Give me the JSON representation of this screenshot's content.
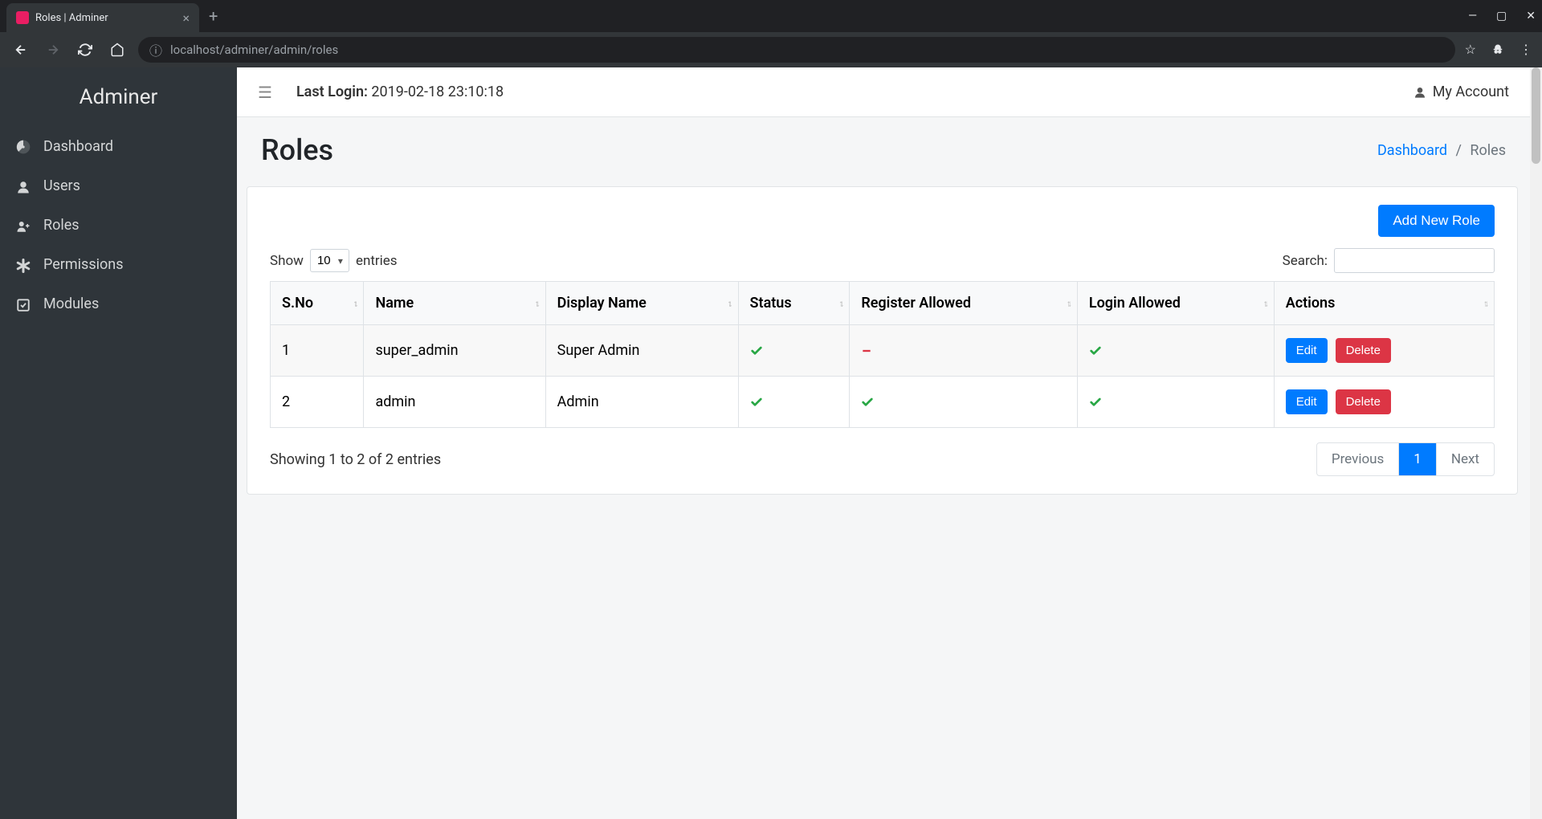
{
  "browser": {
    "tab_title": "Roles | Adminer",
    "url_display": "localhost/adminer/admin/roles"
  },
  "sidebar": {
    "brand": "Adminer",
    "items": [
      {
        "label": "Dashboard",
        "icon": "dashboard"
      },
      {
        "label": "Users",
        "icon": "user"
      },
      {
        "label": "Roles",
        "icon": "user-plus"
      },
      {
        "label": "Permissions",
        "icon": "asterisk"
      },
      {
        "label": "Modules",
        "icon": "check-square"
      }
    ]
  },
  "topbar": {
    "last_login_label": "Last Login:",
    "last_login_value": "2019-02-18 23:10:18",
    "my_account": "My Account"
  },
  "page": {
    "title": "Roles",
    "breadcrumb": {
      "dashboard": "Dashboard",
      "current": "Roles"
    },
    "add_button": "Add New Role"
  },
  "datatable": {
    "show_label": "Show",
    "entries_label": "entries",
    "length_value": "10",
    "search_label": "Search:",
    "search_value": "",
    "columns": [
      "S.No",
      "Name",
      "Display Name",
      "Status",
      "Register Allowed",
      "Login Allowed",
      "Actions"
    ],
    "rows": [
      {
        "sno": "1",
        "name": "super_admin",
        "display_name": "Super Admin",
        "status": true,
        "register_allowed": false,
        "login_allowed": true
      },
      {
        "sno": "2",
        "name": "admin",
        "display_name": "Admin",
        "status": true,
        "register_allowed": true,
        "login_allowed": true
      }
    ],
    "edit_label": "Edit",
    "delete_label": "Delete",
    "info": "Showing 1 to 2 of 2 entries",
    "prev": "Previous",
    "next": "Next",
    "page_current": "1"
  }
}
